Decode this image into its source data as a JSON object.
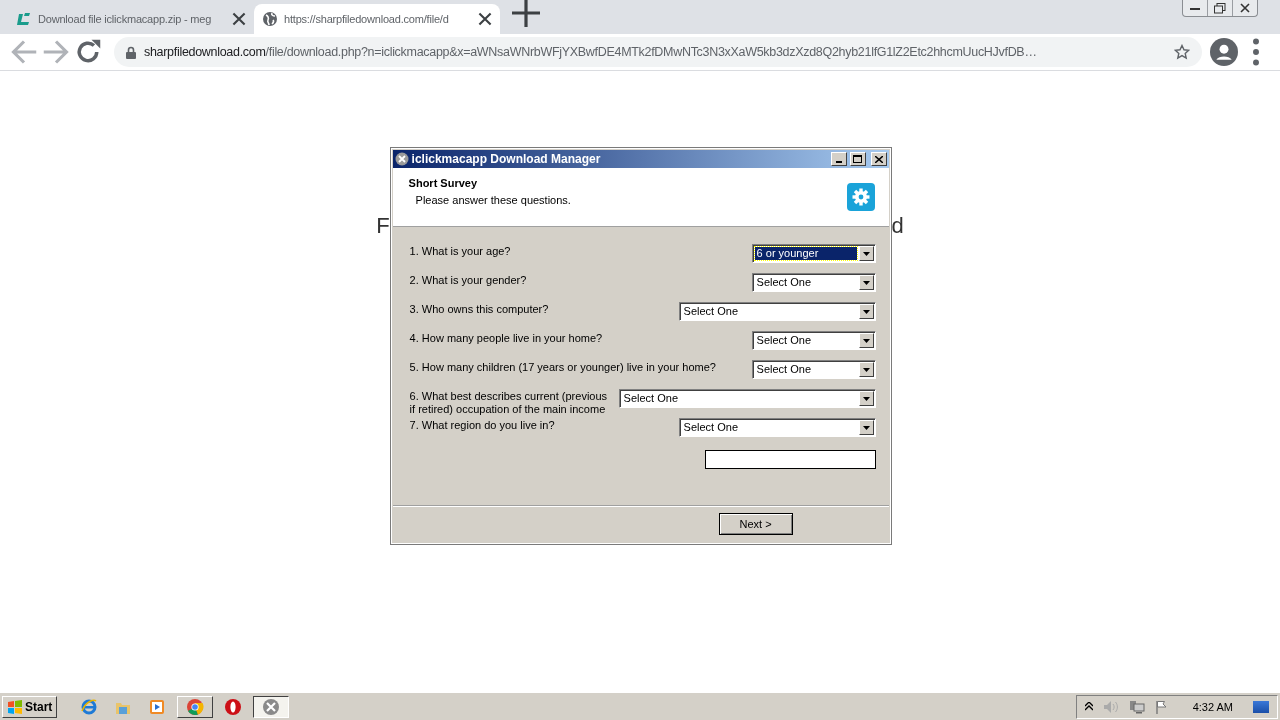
{
  "browser": {
    "tabs": [
      {
        "title": "Download file iclickmacapp.zip - meg",
        "kind": "site",
        "selected": false
      },
      {
        "title": "https://sharpfiledownload.com/file/d",
        "kind": "globe",
        "selected": true
      }
    ],
    "address": {
      "host": "sharpfiledownload.com",
      "path": "/file/download.php?n=iclickmacapp&x=aWNsaWNrbWFjYXBwfDE4MTk2fDMwNTc3N3xXaW5kb3dzXzd8Q2hyb21lfG1lZ2Etc2hhcmUucHJvfDB…"
    }
  },
  "page": {
    "heading_left": "F",
    "heading_right": "d"
  },
  "dialog": {
    "title": "iclickmacapp Download Manager",
    "heading": "Short Survey",
    "subheading": "Please answer these questions.",
    "questions": [
      {
        "label": "1. What is your age?",
        "value": "6 or younger",
        "focused": true
      },
      {
        "label": "2. What is your gender?",
        "value": "Select One",
        "focused": false
      },
      {
        "label": "3. Who owns this computer?",
        "value": "Select One",
        "focused": false
      },
      {
        "label": "4. How many people live in your home?",
        "value": "Select One",
        "focused": false
      },
      {
        "label": "5. How many children (17 years or younger) live in your home?",
        "value": "Select One",
        "focused": false
      },
      {
        "label": "6. What best describes current (previous if retired) occupation of the main income",
        "value": "Select One",
        "focused": false
      },
      {
        "label": "7. What region do you live in?",
        "value": "Select One",
        "focused": false
      }
    ],
    "next_button": "Next >"
  },
  "taskbar": {
    "start": "Start",
    "items": [
      {
        "kind": "ie",
        "running": false,
        "active": false
      },
      {
        "kind": "folder",
        "running": false,
        "active": false
      },
      {
        "kind": "media",
        "running": false,
        "active": false
      },
      {
        "kind": "chrome",
        "running": true,
        "active": false
      },
      {
        "kind": "opera",
        "running": false,
        "active": false
      },
      {
        "kind": "app",
        "running": true,
        "active": true
      }
    ],
    "clock": "4:32 AM"
  }
}
